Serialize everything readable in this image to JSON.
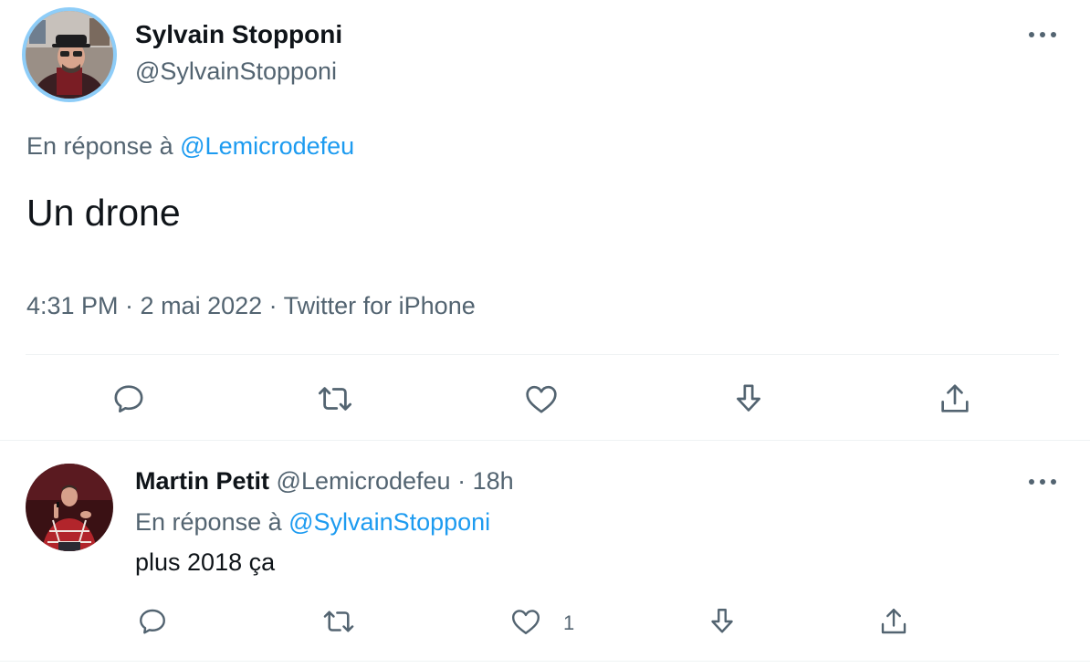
{
  "main_tweet": {
    "author_name": "Sylvain Stopponi",
    "author_handle": "@SylvainStopponi",
    "reply_prefix": "En réponse à",
    "reply_to": "@Lemicrodefeu",
    "text": "Un drone",
    "timestamp": "4:31 PM · 2 mai 2022 · Twitter for iPhone",
    "actions": [
      "reply-icon",
      "retweet-icon",
      "like-icon",
      "bookmark-icon",
      "share-icon"
    ]
  },
  "reply_tweet": {
    "author_name": "Martin Petit",
    "author_handle": "@Lemicrodefeu",
    "separator": "·",
    "time_ago": "18h",
    "reply_prefix": "En réponse à",
    "reply_to": "@SylvainStopponi",
    "text": "plus 2018 ça",
    "like_count": "1",
    "actions": [
      "reply-icon",
      "retweet-icon",
      "like-icon",
      "bookmark-icon",
      "share-icon"
    ]
  },
  "colors": {
    "text": "#0f1419",
    "muted": "#536471",
    "link": "#1d9bf0",
    "divider": "#eff3f4",
    "avatar_ring": "#8ecdf8"
  }
}
